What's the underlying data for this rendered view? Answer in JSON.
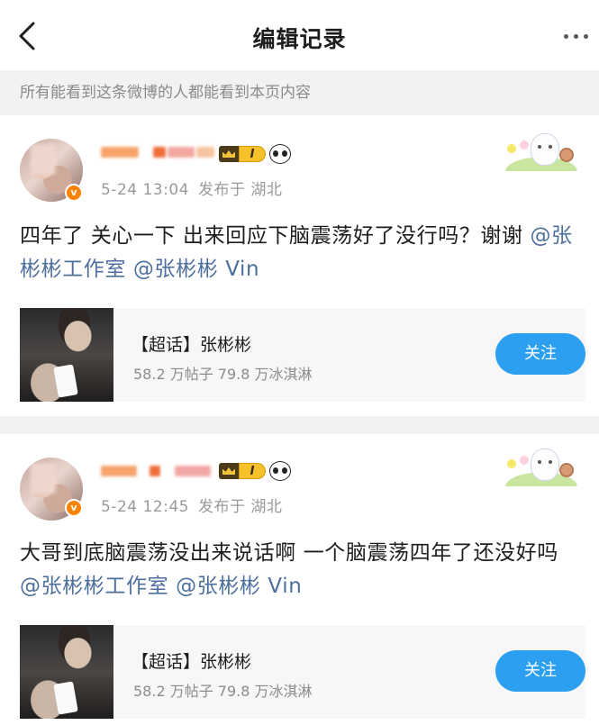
{
  "header": {
    "title": "编辑记录"
  },
  "notice": "所有能看到这条微博的人都能看到本页内容",
  "posts": [
    {
      "date": "5-24 13:04",
      "source": "发布于 湖北",
      "level": "I",
      "content_text": "四年了 关心一下 出来回应下脑震荡好了没行吗？谢谢 ",
      "mention1": "@张彬彬工作室",
      "mention2": "@张彬彬 Vin",
      "topic": {
        "title": "【超话】张彬彬",
        "stats": "58.2 万帖子 79.8 万冰淇淋",
        "follow_label": "关注"
      }
    },
    {
      "date": "5-24 12:45",
      "source": "发布于 湖北",
      "level": "I",
      "content_text": "大哥到底脑震荡没出来说话啊 一个脑震荡四年了还没好吗 ",
      "mention1": "@张彬彬工作室",
      "mention2": "@张彬彬 Vin",
      "topic": {
        "title": "【超话】张彬彬",
        "stats": "58.2 万帖子 79.8 万冰淇淋",
        "follow_label": "关注"
      }
    }
  ],
  "colors": {
    "accent": "#2d9ff0",
    "mention": "#4d6f9e",
    "verified_badge": "#ff8200"
  }
}
